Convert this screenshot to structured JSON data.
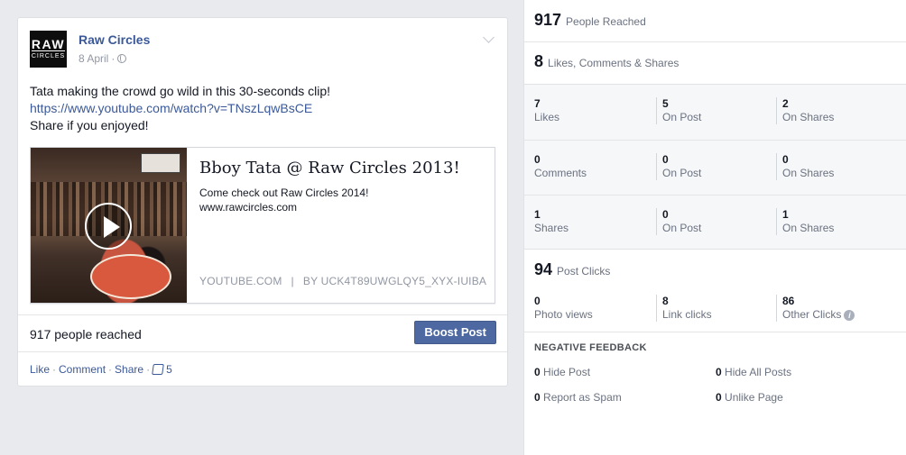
{
  "post": {
    "page_name": "Raw Circles",
    "logo": {
      "top": "RAW",
      "bottom": "CIRCLES"
    },
    "date": "8 April",
    "date_sep": "·",
    "text_line1": "Tata making the crowd go wild in this 30-seconds clip!",
    "link": "https://www.youtube.com/watch?v=TNszLqwBsCE",
    "text_line3": "Share if you enjoyed!",
    "preview": {
      "title": "Bboy Tata @ Raw Circles 2013!",
      "desc_line1": "Come check out Raw Circles 2014!",
      "desc_line2": "www.rawcircles.com",
      "source": "YOUTUBE.COM",
      "source_sep": "|",
      "byline": "BY UCK4T89UWGLQY5_XYX-IUIBA"
    },
    "reach_text": "917 people reached",
    "boost_label": "Boost Post",
    "actions": {
      "like": "Like",
      "comment": "Comment",
      "share": "Share",
      "sep": "·",
      "like_count": "5"
    }
  },
  "insights": {
    "reached": {
      "num": "917",
      "label": "People Reached"
    },
    "engagement": {
      "num": "8",
      "label": "Likes, Comments & Shares"
    },
    "rows": [
      {
        "c1": {
          "num": "7",
          "lbl": "Likes"
        },
        "c2": {
          "num": "5",
          "lbl": "On Post"
        },
        "c3": {
          "num": "2",
          "lbl": "On Shares"
        }
      },
      {
        "c1": {
          "num": "0",
          "lbl": "Comments"
        },
        "c2": {
          "num": "0",
          "lbl": "On Post"
        },
        "c3": {
          "num": "0",
          "lbl": "On Shares"
        }
      },
      {
        "c1": {
          "num": "1",
          "lbl": "Shares"
        },
        "c2": {
          "num": "0",
          "lbl": "On Post"
        },
        "c3": {
          "num": "1",
          "lbl": "On Shares"
        }
      }
    ],
    "clicks": {
      "num": "94",
      "label": "Post Clicks"
    },
    "clicks_row": {
      "c1": {
        "num": "0",
        "lbl": "Photo views"
      },
      "c2": {
        "num": "8",
        "lbl": "Link clicks"
      },
      "c3": {
        "num": "86",
        "lbl": "Other Clicks"
      }
    },
    "info_icon": "i",
    "negative": {
      "title": "NEGATIVE FEEDBACK",
      "hide_post": {
        "num": "0",
        "lbl": "Hide Post"
      },
      "hide_all": {
        "num": "0",
        "lbl": "Hide All Posts"
      },
      "spam": {
        "num": "0",
        "lbl": "Report as Spam"
      },
      "unlike": {
        "num": "0",
        "lbl": "Unlike Page"
      }
    }
  },
  "icons": {
    "globe": "globe-icon",
    "chevron": "chevron-down-icon",
    "play": "play-icon",
    "like": "thumbs-up-icon",
    "info": "info-icon"
  },
  "colors": {
    "link_blue": "#3b5998",
    "boost_blue": "#4e69a2",
    "page_bg": "#e9eaed",
    "muted": "#9197a3"
  }
}
